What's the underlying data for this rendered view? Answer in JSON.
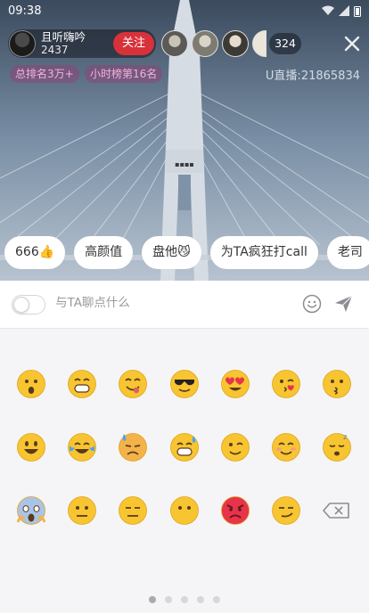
{
  "status_bar": {
    "time": "09:38"
  },
  "host": {
    "name": "且听嗨吟",
    "fans": "2437",
    "follow_label": "关注"
  },
  "viewers": {
    "count": "324"
  },
  "ranks": {
    "total": "总排名3万+",
    "hourly": "小时榜第16名"
  },
  "live_id": "U直播:21865834",
  "quick_replies": [
    "666👍",
    "高颜值",
    "盘他😼",
    "为TA疯狂打call",
    "老司"
  ],
  "chat_input": {
    "placeholder": "与TA聊点什么",
    "value": ""
  },
  "emoji_grid": {
    "rows": [
      [
        "surprised-face",
        "grinning-face",
        "yum-face",
        "sunglasses-face",
        "heart-eyes-face",
        "kissing-heart-face",
        "kissing-face"
      ],
      [
        "big-smile-face",
        "tears-of-joy-face",
        "sweat-frown-face",
        "sweat-smile-face",
        "winking-face",
        "blushing-smile-face",
        "sleeping-face"
      ],
      [
        "screaming-face",
        "neutral-face",
        "expressionless-face",
        "no-mouth-face",
        "angry-face",
        "smirking-face",
        "backspace-key"
      ]
    ]
  },
  "pager": {
    "pages": 5,
    "current": 1
  },
  "colors": {
    "follow": "#d8313a",
    "emoji_yellow": "#f7c531",
    "rank_text": "#f1b4dc"
  }
}
